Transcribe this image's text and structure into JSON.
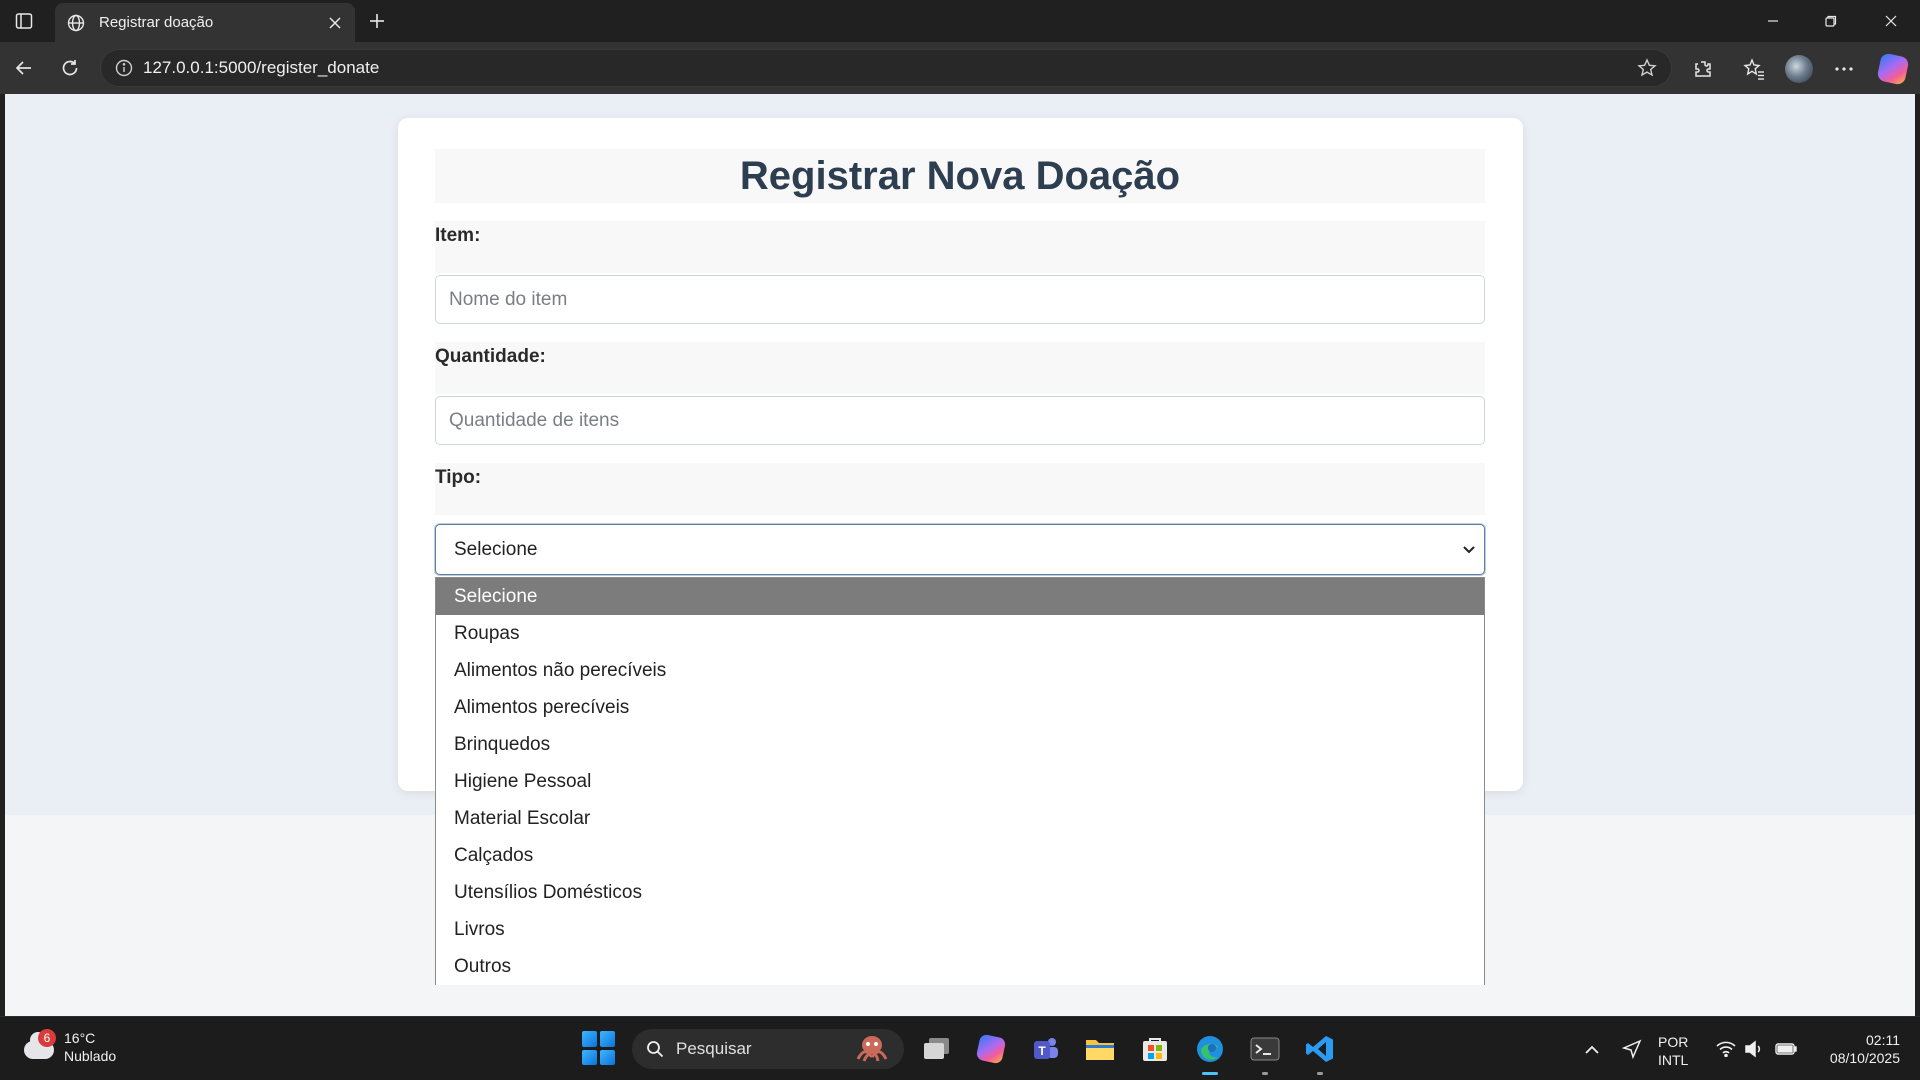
{
  "browser": {
    "tab_title": "Registrar doação",
    "url": "127.0.0.1:5000/register_donate"
  },
  "form": {
    "title": "Registrar Nova Doação",
    "item_label": "Item:",
    "item_placeholder": "Nome do item",
    "item_value": "",
    "quantity_label": "Quantidade:",
    "quantity_placeholder": "Quantidade de itens",
    "quantity_value": "",
    "type_label": "Tipo:",
    "type_selected": "Selecione",
    "type_options": [
      "Selecione",
      "Roupas",
      "Alimentos não perecíveis",
      "Alimentos perecíveis",
      "Brinquedos",
      "Higiene Pessoal",
      "Material Escolar",
      "Calçados",
      "Utensílios Domésticos",
      "Livros",
      "Outros"
    ]
  },
  "taskbar": {
    "weather_temp": "16°C",
    "weather_desc": "Nublado",
    "weather_badge": "6",
    "search_label": "Pesquisar",
    "lang_primary": "POR",
    "lang_secondary": "INTL",
    "time": "02:11",
    "date": "08/10/2025"
  },
  "colors": {
    "title_text": "#2c3e50",
    "selected_option_bg": "#7c7c7c",
    "page_background": "#eaeff5",
    "taskbar_accent": "#4cc2ff"
  }
}
